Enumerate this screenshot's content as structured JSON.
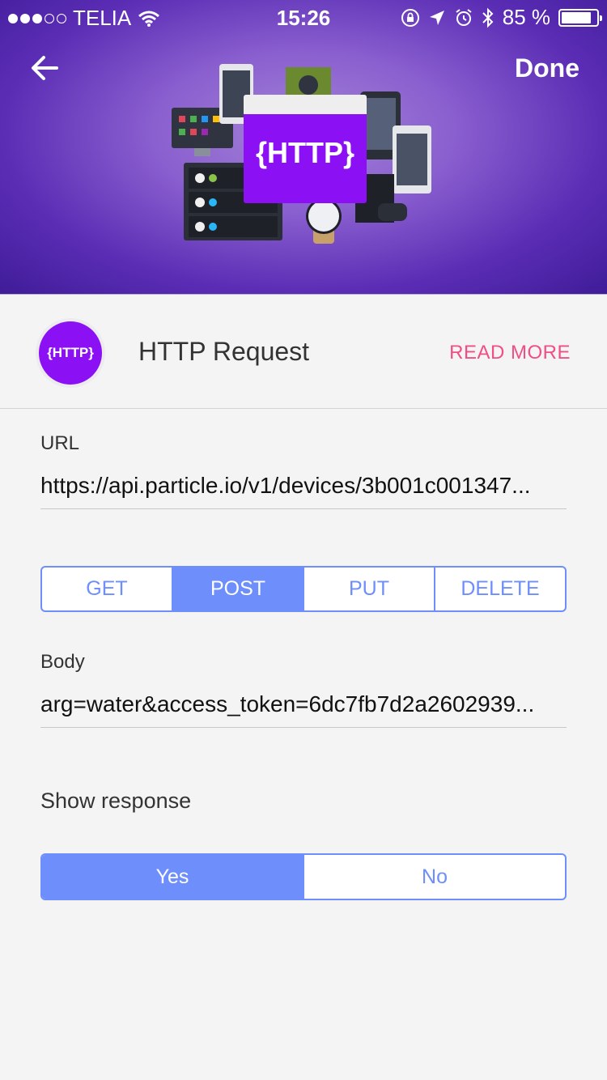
{
  "status_bar": {
    "carrier": "TELIA",
    "time": "15:26",
    "battery": "85 %",
    "battery_level": 0.85
  },
  "nav": {
    "done_label": "Done"
  },
  "service": {
    "logo_text": "{HTTP}",
    "title": "HTTP Request",
    "read_more": "READ MORE",
    "hero_badge": "{HTTP}"
  },
  "url_field": {
    "label": "URL",
    "value": "https://api.particle.io/v1/devices/3b001c001347..."
  },
  "method": {
    "options": [
      "GET",
      "POST",
      "PUT",
      "DELETE"
    ],
    "selected": "POST"
  },
  "body_field": {
    "label": "Body",
    "value": "arg=water&access_token=6dc7fb7d2a2602939..."
  },
  "show_response": {
    "label": "Show response",
    "options": [
      "Yes",
      "No"
    ],
    "selected": "Yes"
  },
  "colors": {
    "accent": "#6e8ffb",
    "read_more": "#ef4f84",
    "brand": "#8b10f3"
  }
}
